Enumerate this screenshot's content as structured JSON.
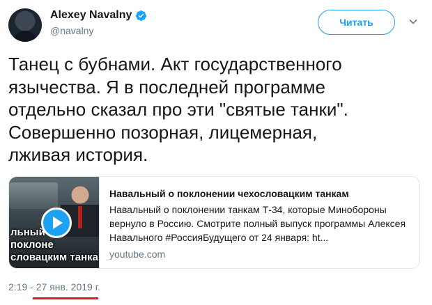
{
  "author": {
    "name": "Alexey Navalny",
    "handle": "@navalny",
    "verified": true
  },
  "follow_button": {
    "label": "Читать"
  },
  "tweet": {
    "text": "Танец с бубнами. Акт государственного\nязычества. Я в последней программе\nотдельно сказал про эти \"святые танки\".\nСовершенно позорная, лицемерная,\nлживая история."
  },
  "card": {
    "thumbnail_caption": "льный о поклоне\nсловацким танка",
    "title": "Навальный о поклонении чехословацким танкам",
    "description": "Навальный о поклонении танкам Т-34, которые Минобороны вернуло в Россию. Смотрите полный выпуск программы Алексея Навального #РоссияБудущего от 24 января: ht...",
    "domain": "youtube.com"
  },
  "timestamp": "2:19 - 27 янв. 2019 г.",
  "colors": {
    "accent": "#1da1f2",
    "text": "#14171a",
    "muted": "#657786",
    "annotation": "#e0171d"
  }
}
